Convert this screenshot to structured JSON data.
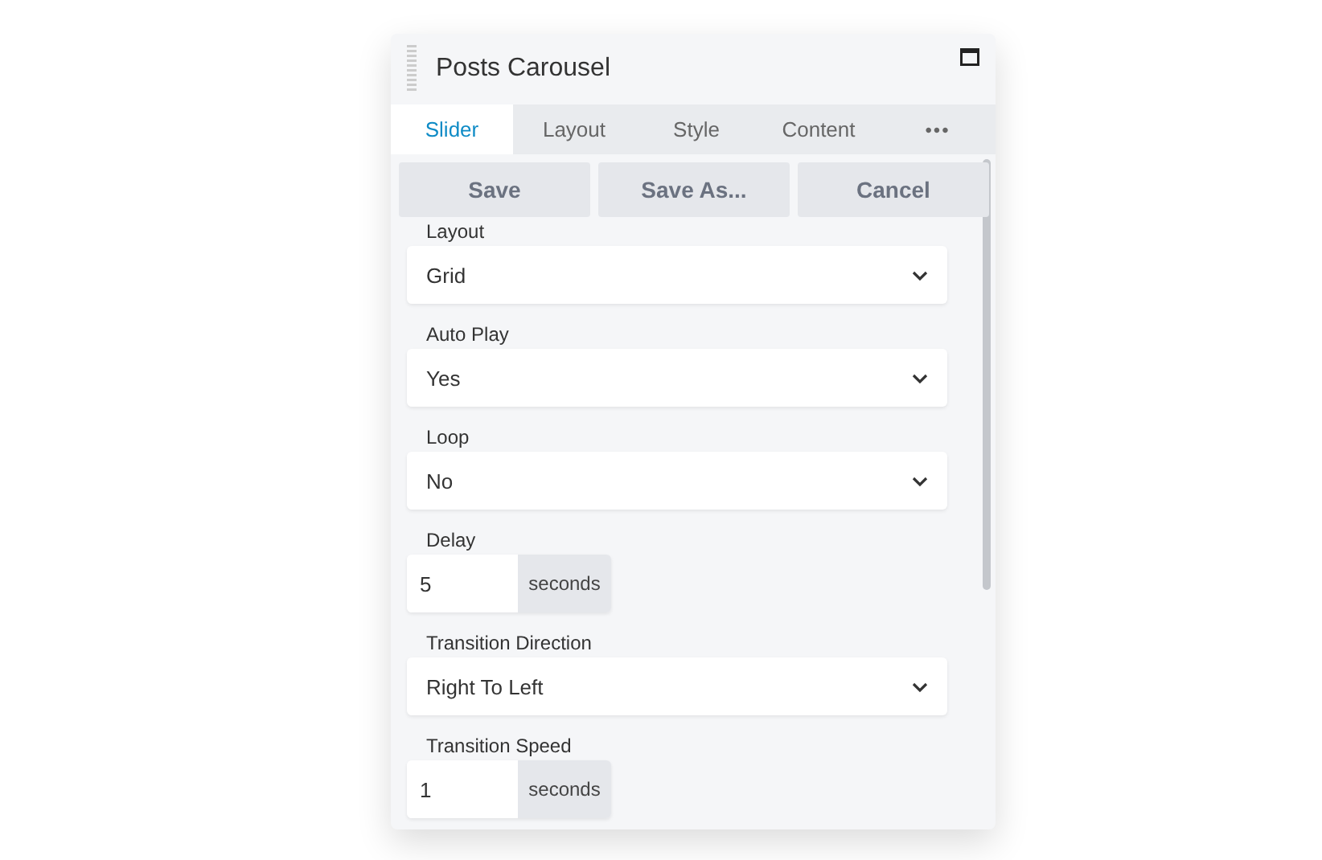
{
  "panel": {
    "title": "Posts Carousel"
  },
  "tabs": [
    {
      "label": "Slider",
      "selected": true
    },
    {
      "label": "Layout",
      "selected": false
    },
    {
      "label": "Style",
      "selected": false
    },
    {
      "label": "Content",
      "selected": false
    }
  ],
  "more": "•••",
  "buttons": [
    "Save",
    "Save As...",
    "Cancel"
  ],
  "fields": [
    {
      "kind": "select",
      "label": "Layout",
      "value": "Grid"
    },
    {
      "kind": "select",
      "label": "Auto Play",
      "value": "Yes"
    },
    {
      "kind": "select",
      "label": "Loop",
      "value": "No"
    },
    {
      "kind": "number",
      "label": "Delay",
      "value": "5",
      "unit": "seconds"
    },
    {
      "kind": "select",
      "label": "Transition Direction",
      "value": "Right To Left"
    },
    {
      "kind": "number",
      "label": "Transition Speed",
      "value": "1",
      "unit": "seconds"
    }
  ]
}
